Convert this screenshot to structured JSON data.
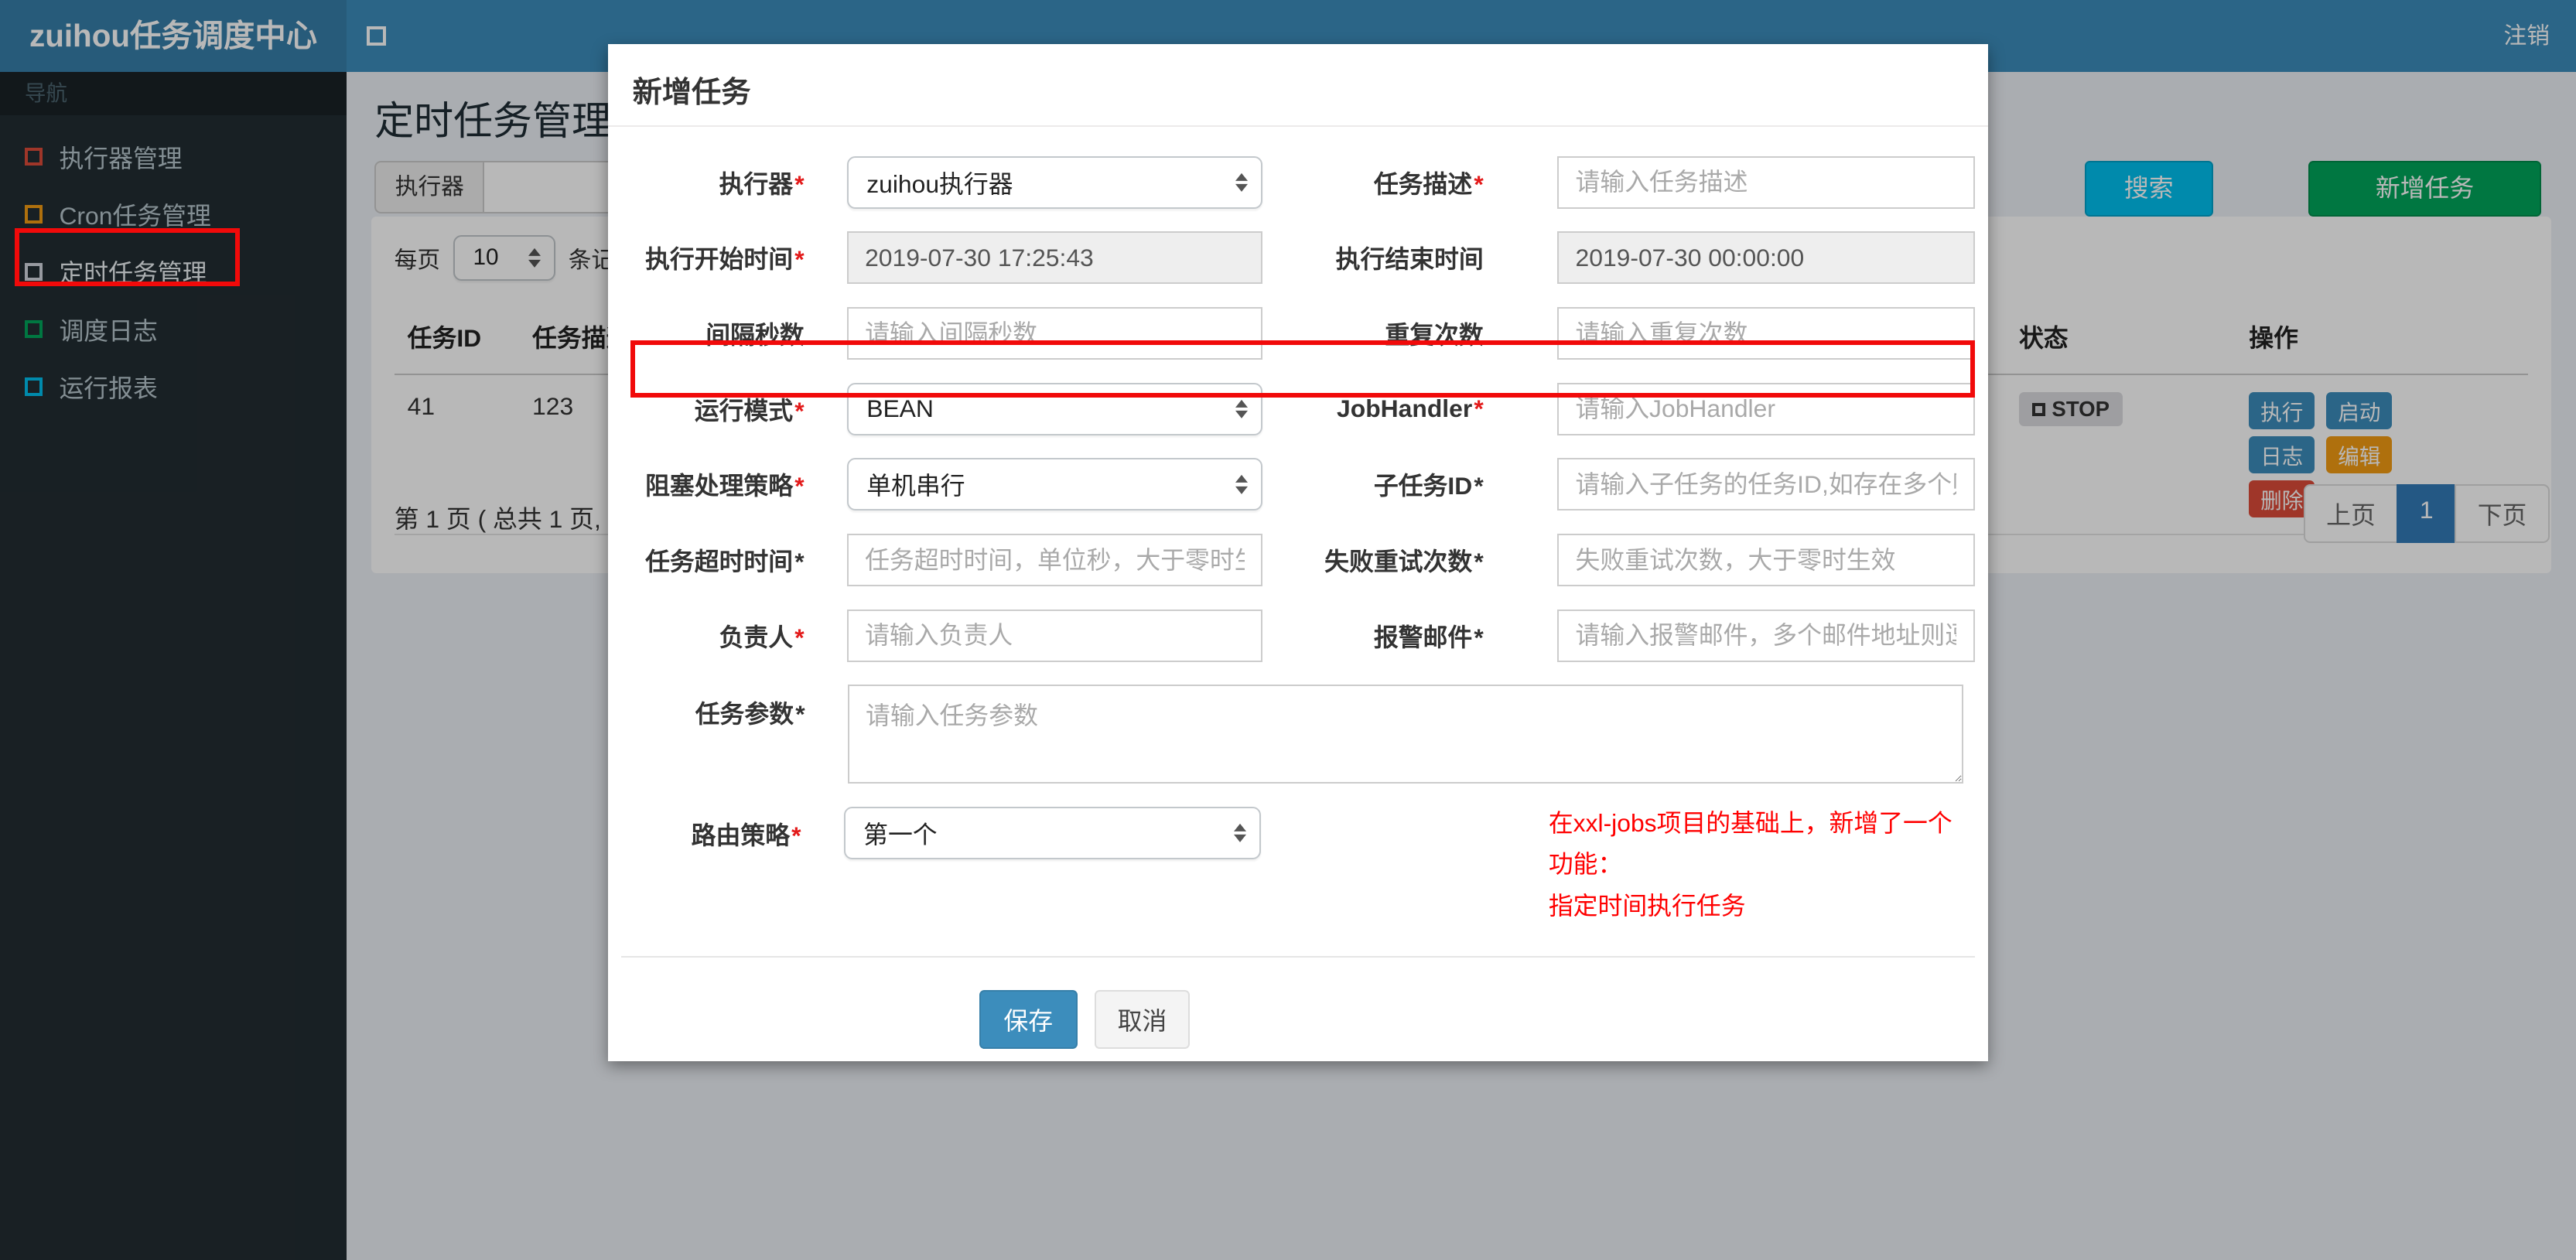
{
  "topbar": {
    "brand": "zuihou任务调度中心",
    "logout": "注销"
  },
  "sidebar": {
    "nav_label": "导航",
    "items": [
      {
        "label": "执行器管理",
        "icon_color": "#dd4b39"
      },
      {
        "label": "Cron任务管理",
        "icon_color": "#f39c12"
      },
      {
        "label": "定时任务管理",
        "icon_color": "#d2d6de"
      },
      {
        "label": "调度日志",
        "icon_color": "#00a65a"
      },
      {
        "label": "运行报表",
        "icon_color": "#00c0ef"
      }
    ]
  },
  "page": {
    "title": "定时任务管理",
    "filter": {
      "executor_label": "执行器",
      "search_label": "搜索",
      "add_label": "新增任务"
    },
    "per_page": {
      "prefix": "每页",
      "value": "10",
      "suffix": "条记录"
    },
    "table": {
      "headers": [
        "任务ID",
        "任务描述",
        "状态",
        "操作"
      ],
      "row": {
        "id": "41",
        "desc": "123",
        "status": "STOP",
        "actions": [
          "执行",
          "启动",
          "日志",
          "编辑",
          "删除"
        ]
      }
    },
    "pagination": {
      "info": "第 1 页 ( 总共 1 页, 1",
      "prev": "上页",
      "current": "1",
      "next": "下页"
    }
  },
  "modal": {
    "title": "新增任务",
    "star": "*",
    "fields": {
      "executor": {
        "label": "执行器",
        "value": "zuihou执行器"
      },
      "desc": {
        "label": "任务描述",
        "placeholder": "请输入任务描述"
      },
      "start": {
        "label": "执行开始时间",
        "value": "2019-07-30 17:25:43"
      },
      "end": {
        "label": "执行结束时间",
        "value": "2019-07-30 00:00:00"
      },
      "interval": {
        "label": "间隔秒数",
        "placeholder": "请输入间隔秒数"
      },
      "repeat": {
        "label": "重复次数",
        "placeholder": "请输入重复次数"
      },
      "runmode": {
        "label": "运行模式",
        "value": "BEAN"
      },
      "handler": {
        "label": "JobHandler",
        "placeholder": "请输入JobHandler"
      },
      "block": {
        "label": "阻塞处理策略",
        "value": "单机串行"
      },
      "child": {
        "label": "子任务ID",
        "placeholder": "请输入子任务的任务ID,如存在多个则逗号分隔"
      },
      "timeout": {
        "label": "任务超时时间",
        "placeholder": "任务超时时间，单位秒，大于零时生效"
      },
      "retry": {
        "label": "失败重试次数",
        "placeholder": "失败重试次数，大于零时生效"
      },
      "author": {
        "label": "负责人",
        "placeholder": "请输入负责人"
      },
      "email": {
        "label": "报警邮件",
        "placeholder": "请输入报警邮件，多个邮件地址则逗号分隔"
      },
      "param": {
        "label": "任务参数",
        "placeholder": "请输入任务参数"
      },
      "route": {
        "label": "路由策略",
        "value": "第一个"
      }
    },
    "note_line1": "在xxl-jobs项目的基础上，新增了一个功能：",
    "note_line2": "指定时间执行任务",
    "save_label": "保存",
    "cancel_label": "取消"
  },
  "colors": {
    "topbar": "#3c8dbc",
    "logo": "#367fa9",
    "sidebar": "#222d32",
    "annotation_red": "#f10a0a",
    "primary": "#3c8dbc",
    "info": "#00c0ef",
    "success": "#00a65a",
    "warning": "#f39c12",
    "danger": "#dd4b39",
    "pager_active": "#337ab7"
  }
}
